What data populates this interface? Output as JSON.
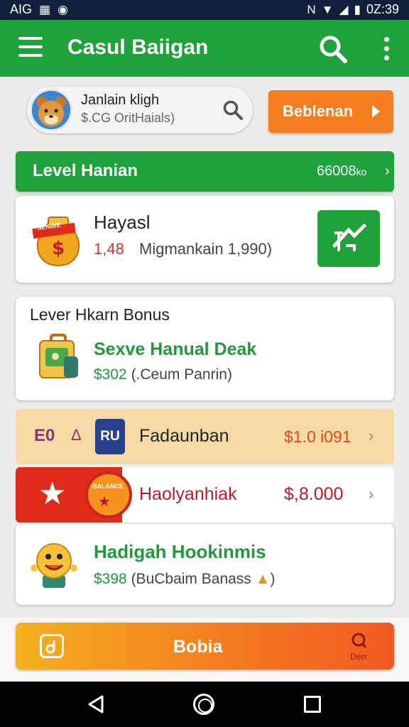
{
  "status_bar": {
    "left_text": "AIG",
    "time": "0Z:39"
  },
  "app_bar": {
    "title": "Casul Baiigan"
  },
  "profile": {
    "name": "Janlain kligh",
    "subtitle": "$.CG OritHaials)"
  },
  "action_button": {
    "label": "Beblenan"
  },
  "level_bar": {
    "label": "Level Hanian",
    "value": "66008",
    "unit": "ko"
  },
  "card1": {
    "title": "Hayasl",
    "amount": "1,48",
    "description": "Migmankain 1,990)",
    "icon_text": "SENIBE"
  },
  "card2": {
    "heading": "Lever Hkarn Bonus",
    "title": "Sexve Hanual Deak",
    "amount": "$302",
    "detail": "(.Ceum Panrin)"
  },
  "row1": {
    "icon_left": "E0",
    "icon_mid": "Δ",
    "badge": "RU",
    "label": "Fadaunban",
    "price": "$1.0 i091"
  },
  "row2": {
    "label": "Haolyanhiak",
    "price": "$,8.000",
    "badge_text": "BALANCE"
  },
  "card3": {
    "title": "Hadigah Hookinmis",
    "amount": "$398",
    "detail": "(BuCbaim Banass"
  },
  "bottom_button": {
    "label": "Bobia",
    "right_label": "Derr"
  },
  "icons": {
    "menu": "hamburger-icon",
    "search": "search-icon",
    "more": "more-vert-icon",
    "back": "back-icon",
    "home": "home-icon",
    "recent": "recent-apps-icon"
  },
  "colors": {
    "primary_green": "#1fa23c",
    "orange": "#f57c1f",
    "red": "#e02a1a",
    "peach": "#f7d9a6",
    "navy": "#0f1f3d",
    "text_red": "#c4172a"
  }
}
